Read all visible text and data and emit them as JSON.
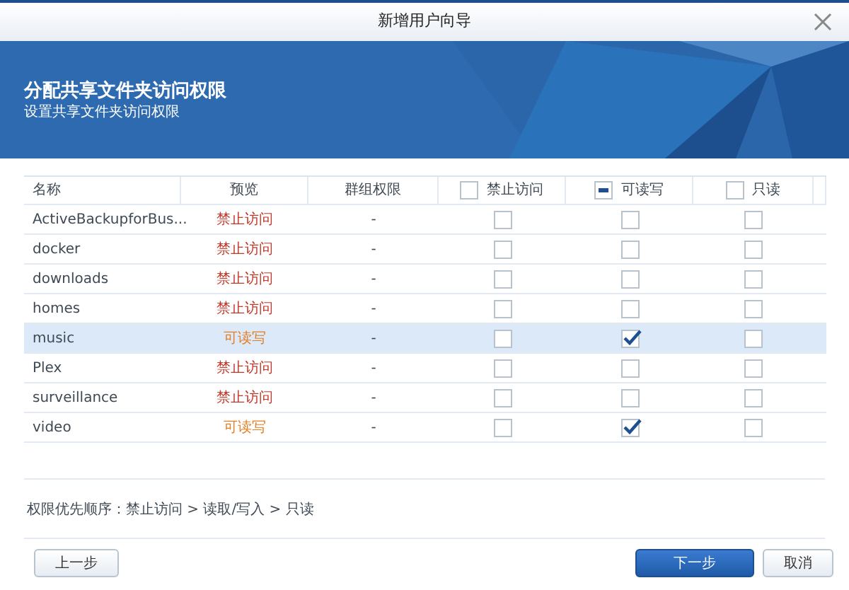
{
  "window": {
    "title": "新增用户向导"
  },
  "banner": {
    "title": "分配共享文件夹访问权限",
    "subtitle": "设置共享文件夹访问权限"
  },
  "table": {
    "columns": [
      {
        "label": "名称",
        "kind": "text"
      },
      {
        "label": "预览",
        "kind": "text"
      },
      {
        "label": "群组权限",
        "kind": "text"
      },
      {
        "label": "禁止访问",
        "kind": "check",
        "mixed": false
      },
      {
        "label": "可读写",
        "kind": "check",
        "mixed": true
      },
      {
        "label": "只读",
        "kind": "check",
        "mixed": false
      }
    ],
    "rows": [
      {
        "name": "ActiveBackupforBus...",
        "preview": "禁止访问",
        "color": "#c0392b",
        "group": "-",
        "deny": false,
        "readwrite": false,
        "readonly": false,
        "selected": false
      },
      {
        "name": "docker",
        "preview": "禁止访问",
        "color": "#c0392b",
        "group": "-",
        "deny": false,
        "readwrite": false,
        "readonly": false,
        "selected": false
      },
      {
        "name": "downloads",
        "preview": "禁止访问",
        "color": "#c0392b",
        "group": "-",
        "deny": false,
        "readwrite": false,
        "readonly": false,
        "selected": false
      },
      {
        "name": "homes",
        "preview": "禁止访问",
        "color": "#c0392b",
        "group": "-",
        "deny": false,
        "readwrite": false,
        "readonly": false,
        "selected": false
      },
      {
        "name": "music",
        "preview": "可读写",
        "color": "#e67e22",
        "group": "-",
        "deny": false,
        "readwrite": true,
        "readonly": false,
        "selected": true
      },
      {
        "name": "Plex",
        "preview": "禁止访问",
        "color": "#c0392b",
        "group": "-",
        "deny": false,
        "readwrite": false,
        "readonly": false,
        "selected": false
      },
      {
        "name": "surveillance",
        "preview": "禁止访问",
        "color": "#c0392b",
        "group": "-",
        "deny": false,
        "readwrite": false,
        "readonly": false,
        "selected": false
      },
      {
        "name": "video",
        "preview": "可读写",
        "color": "#e67e22",
        "group": "-",
        "deny": false,
        "readwrite": true,
        "readonly": false,
        "selected": false
      }
    ]
  },
  "footer_note": "权限优先顺序：禁止访问 > 读取/写入 > 只读",
  "buttons": [
    {
      "label": "上一步",
      "kind": "secondary"
    },
    {
      "label": "下一步",
      "kind": "primary"
    },
    {
      "label": "取消",
      "kind": "secondary"
    }
  ]
}
